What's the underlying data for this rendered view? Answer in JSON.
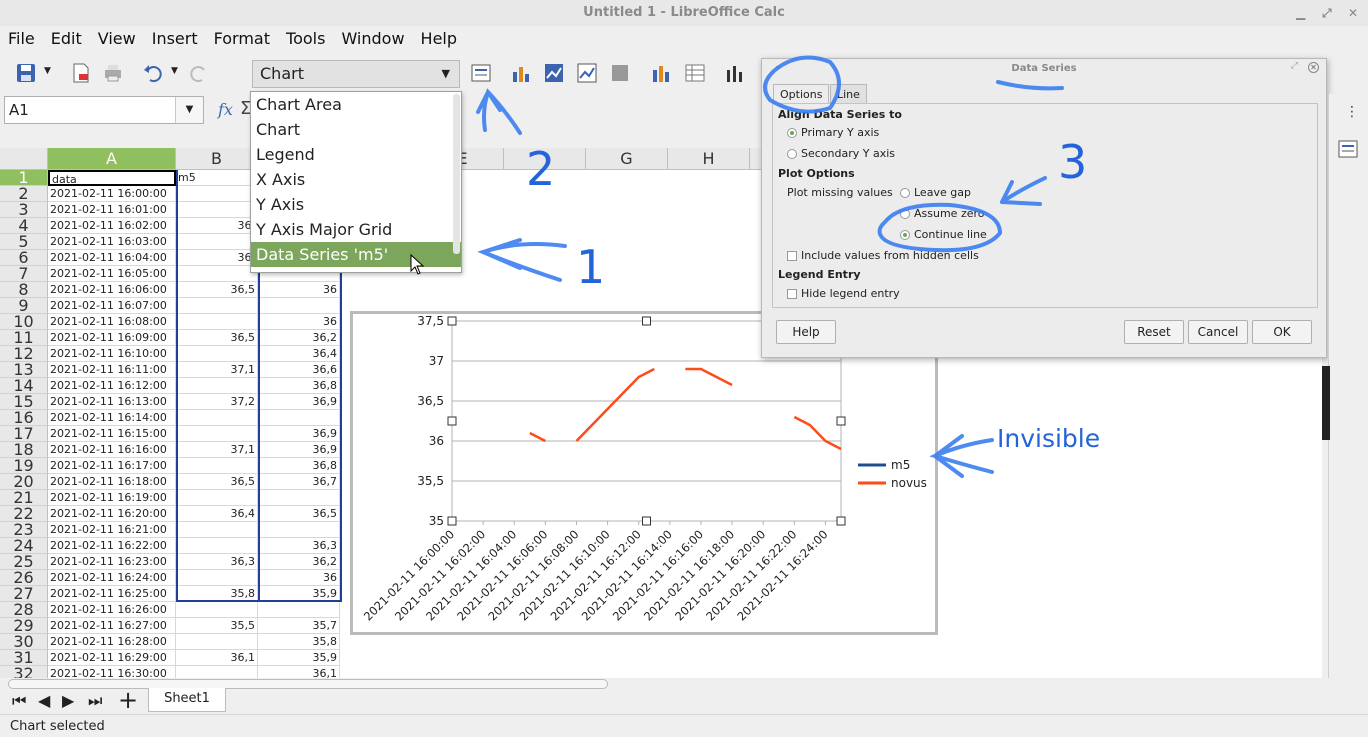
{
  "window": {
    "title": "Untitled 1 - LibreOffice Calc"
  },
  "menu": [
    "File",
    "Edit",
    "View",
    "Insert",
    "Format",
    "Tools",
    "Window",
    "Help"
  ],
  "toolbar": {
    "element_select": "Chart"
  },
  "namebox": {
    "value": "A1"
  },
  "columns": [
    "A",
    "B",
    "E",
    "G",
    "H"
  ],
  "rows": [
    {
      "n": "1",
      "a": "data",
      "b": "m5",
      "c": ""
    },
    {
      "n": "2",
      "a": "2021-02-11 16:00:00",
      "b": "",
      "c": ""
    },
    {
      "n": "3",
      "a": "2021-02-11 16:01:00",
      "b": "",
      "c": ""
    },
    {
      "n": "4",
      "a": "2021-02-11 16:02:00",
      "b": "36,",
      "c": ""
    },
    {
      "n": "5",
      "a": "2021-02-11 16:03:00",
      "b": "",
      "c": ""
    },
    {
      "n": "6",
      "a": "2021-02-11 16:04:00",
      "b": "36,",
      "c": ""
    },
    {
      "n": "7",
      "a": "2021-02-11 16:05:00",
      "b": "",
      "c": ""
    },
    {
      "n": "8",
      "a": "2021-02-11 16:06:00",
      "b": "36,5",
      "c": "36"
    },
    {
      "n": "9",
      "a": "2021-02-11 16:07:00",
      "b": "",
      "c": ""
    },
    {
      "n": "10",
      "a": "2021-02-11 16:08:00",
      "b": "",
      "c": "36"
    },
    {
      "n": "11",
      "a": "2021-02-11 16:09:00",
      "b": "36,5",
      "c": "36,2"
    },
    {
      "n": "12",
      "a": "2021-02-11 16:10:00",
      "b": "",
      "c": "36,4"
    },
    {
      "n": "13",
      "a": "2021-02-11 16:11:00",
      "b": "37,1",
      "c": "36,6"
    },
    {
      "n": "14",
      "a": "2021-02-11 16:12:00",
      "b": "",
      "c": "36,8"
    },
    {
      "n": "15",
      "a": "2021-02-11 16:13:00",
      "b": "37,2",
      "c": "36,9"
    },
    {
      "n": "16",
      "a": "2021-02-11 16:14:00",
      "b": "",
      "c": ""
    },
    {
      "n": "17",
      "a": "2021-02-11 16:15:00",
      "b": "",
      "c": "36,9"
    },
    {
      "n": "18",
      "a": "2021-02-11 16:16:00",
      "b": "37,1",
      "c": "36,9"
    },
    {
      "n": "19",
      "a": "2021-02-11 16:17:00",
      "b": "",
      "c": "36,8"
    },
    {
      "n": "20",
      "a": "2021-02-11 16:18:00",
      "b": "36,5",
      "c": "36,7"
    },
    {
      "n": "21",
      "a": "2021-02-11 16:19:00",
      "b": "",
      "c": ""
    },
    {
      "n": "22",
      "a": "2021-02-11 16:20:00",
      "b": "36,4",
      "c": "36,5"
    },
    {
      "n": "23",
      "a": "2021-02-11 16:21:00",
      "b": "",
      "c": ""
    },
    {
      "n": "24",
      "a": "2021-02-11 16:22:00",
      "b": "",
      "c": "36,3"
    },
    {
      "n": "25",
      "a": "2021-02-11 16:23:00",
      "b": "36,3",
      "c": "36,2"
    },
    {
      "n": "26",
      "a": "2021-02-11 16:24:00",
      "b": "",
      "c": "36"
    },
    {
      "n": "27",
      "a": "2021-02-11 16:25:00",
      "b": "35,8",
      "c": "35,9"
    },
    {
      "n": "28",
      "a": "2021-02-11 16:26:00",
      "b": "",
      "c": ""
    },
    {
      "n": "29",
      "a": "2021-02-11 16:27:00",
      "b": "35,5",
      "c": "35,7"
    },
    {
      "n": "30",
      "a": "2021-02-11 16:28:00",
      "b": "",
      "c": "35,8"
    },
    {
      "n": "31",
      "a": "2021-02-11 16:29:00",
      "b": "36,1",
      "c": "35,9"
    },
    {
      "n": "32",
      "a": "2021-02-11 16:30:00",
      "b": "",
      "c": "36,1"
    }
  ],
  "dropdown": {
    "options": [
      "Chart Area",
      "Chart",
      "Legend",
      "X Axis",
      "Y Axis",
      "Y Axis Major Grid",
      "Data Series 'm5'"
    ],
    "selected_index": 6
  },
  "dialog": {
    "title": "Data Series",
    "tabs": [
      "Options",
      "Line"
    ],
    "align_heading": "Align Data Series to",
    "primary_y": "Primary Y axis",
    "secondary_y": "Secondary Y axis",
    "plot_options_heading": "Plot Options",
    "plot_missing_label": "Plot missing values",
    "leave_gap": "Leave gap",
    "assume_zero": "Assume zero",
    "continue_line": "Continue line",
    "include_hidden": "Include values from hidden cells",
    "legend_heading": "Legend Entry",
    "hide_legend": "Hide legend entry",
    "buttons": {
      "help": "Help",
      "reset": "Reset",
      "cancel": "Cancel",
      "ok": "OK"
    }
  },
  "sheet_tab": "Sheet1",
  "status": "Chart selected",
  "annotations": {
    "a1": "1",
    "a2": "2",
    "a3": "3",
    "invisible": "Invisible"
  },
  "chart_data": {
    "type": "line",
    "x": [
      "2021-02-11 16:00:00",
      "2021-02-11 16:01:00",
      "2021-02-11 16:02:00",
      "2021-02-11 16:03:00",
      "2021-02-11 16:04:00",
      "2021-02-11 16:05:00",
      "2021-02-11 16:06:00",
      "2021-02-11 16:07:00",
      "2021-02-11 16:08:00",
      "2021-02-11 16:09:00",
      "2021-02-11 16:10:00",
      "2021-02-11 16:11:00",
      "2021-02-11 16:12:00",
      "2021-02-11 16:13:00",
      "2021-02-11 16:14:00",
      "2021-02-11 16:15:00",
      "2021-02-11 16:16:00",
      "2021-02-11 16:17:00",
      "2021-02-11 16:18:00",
      "2021-02-11 16:19:00",
      "2021-02-11 16:20:00",
      "2021-02-11 16:21:00",
      "2021-02-11 16:22:00",
      "2021-02-11 16:23:00",
      "2021-02-11 16:24:00",
      "2021-02-11 16:25:00"
    ],
    "xtick_labels": [
      "2021-02-11 16:00:00",
      "2021-02-11 16:02:00",
      "2021-02-11 16:04:00",
      "2021-02-11 16:06:00",
      "2021-02-11 16:08:00",
      "2021-02-11 16:10:00",
      "2021-02-11 16:12:00",
      "2021-02-11 16:14:00",
      "2021-02-11 16:16:00",
      "2021-02-11 16:18:00",
      "2021-02-11 16:20:00",
      "2021-02-11 16:22:00",
      "2021-02-11 16:24:00"
    ],
    "ytick_labels": [
      "35",
      "35,5",
      "36",
      "36,5",
      "37",
      "37,5"
    ],
    "ylim": [
      35,
      37.5
    ],
    "series": [
      {
        "name": "m5",
        "color": "#1f4e8c",
        "values": []
      },
      {
        "name": "novus",
        "color": "#ff4a1a",
        "values": [
          null,
          null,
          null,
          null,
          null,
          36.1,
          36,
          null,
          36,
          36.2,
          36.4,
          36.6,
          36.8,
          36.9,
          null,
          36.9,
          36.9,
          36.8,
          36.7,
          null,
          null,
          null,
          36.3,
          36.2,
          36,
          35.9
        ]
      }
    ],
    "legend": "right",
    "grid": true
  }
}
